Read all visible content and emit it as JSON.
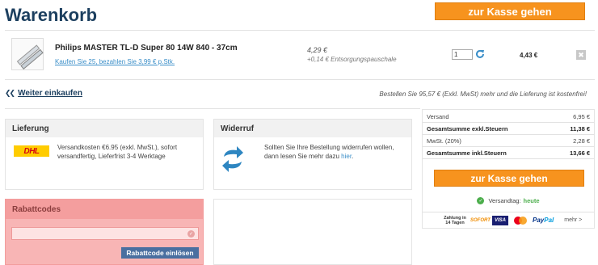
{
  "page": {
    "title": "Warenkorb"
  },
  "header": {
    "checkout_label": "zur Kasse gehen"
  },
  "cart": {
    "item": {
      "name": "Philips MASTER TL-D Super 80 14W 840 - 37cm",
      "promo_link": "Kaufen Sie 25, bezahlen Sie 3,99 € p.Stk.",
      "unit_price": "4,29 €",
      "fee": "+0,14 € Entsorgungspauschale",
      "quantity": "1",
      "total": "4,43 €",
      "remove_symbol": "✖"
    }
  },
  "nav": {
    "continue_shopping": "Weiter einkaufen",
    "free_shipping_note": "Bestellen Sie 95,57 € (Exkl. MwSt) mehr und die Lieferung ist kostenfrei!"
  },
  "delivery": {
    "title": "Lieferung",
    "carrier_logo": "DHL",
    "text": "Versandkosten €6.95 (exkl. MwSt.), sofort versandfertig, Lieferfrist 3-4 Werktage"
  },
  "withdrawal": {
    "title": "Widerruf",
    "text": "Sollten Sie Ihre Bestellung widerrufen wollen, dann lesen Sie mehr dazu ",
    "link": "hier",
    "suffix": "."
  },
  "coupon": {
    "title": "Rabattcodes",
    "input_value": "",
    "button_label": "Rabattcode einlösen"
  },
  "summary": {
    "rows": [
      {
        "label": "Versand",
        "value": "6,95 €"
      },
      {
        "label": "Gesamtsumme exkl.Steuern",
        "value": "11,38 €"
      },
      {
        "label": "MwSt. (20%)",
        "value": "2,28 €"
      },
      {
        "label": "Gesamtsumme inkl.Steuern",
        "value": "13,66 €"
      }
    ],
    "checkout_label": "zur Kasse gehen",
    "ship_day_label": "Versandtag:",
    "ship_day_value": "heute"
  },
  "payment": {
    "invoice": "Zahlung in 14 Tagen",
    "sofort": "SOFORT",
    "visa": "VISA",
    "paypal_1": "Pay",
    "paypal_2": "Pal",
    "more": "mehr >"
  },
  "colors": {
    "brand": "#1c3f5f",
    "accent": "#f7931e",
    "link": "#3a8ec8",
    "success": "#4cae4c",
    "coupon_highlight": "#f8b5b5"
  }
}
